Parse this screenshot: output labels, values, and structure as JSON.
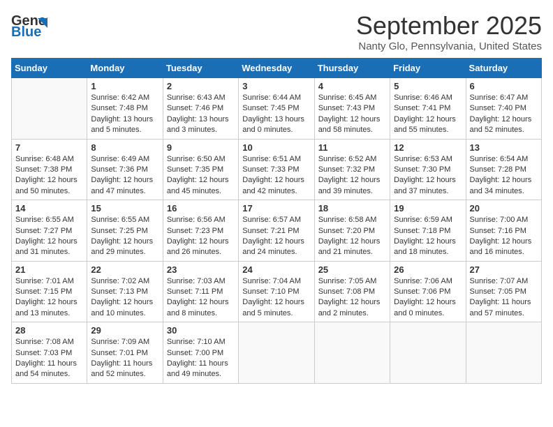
{
  "header": {
    "logo_general": "General",
    "logo_blue": "Blue",
    "month_title": "September 2025",
    "location": "Nanty Glo, Pennsylvania, United States"
  },
  "weekdays": [
    "Sunday",
    "Monday",
    "Tuesday",
    "Wednesday",
    "Thursday",
    "Friday",
    "Saturday"
  ],
  "weeks": [
    [
      {
        "day": "",
        "info": ""
      },
      {
        "day": "1",
        "info": "Sunrise: 6:42 AM\nSunset: 7:48 PM\nDaylight: 13 hours\nand 5 minutes."
      },
      {
        "day": "2",
        "info": "Sunrise: 6:43 AM\nSunset: 7:46 PM\nDaylight: 13 hours\nand 3 minutes."
      },
      {
        "day": "3",
        "info": "Sunrise: 6:44 AM\nSunset: 7:45 PM\nDaylight: 13 hours\nand 0 minutes."
      },
      {
        "day": "4",
        "info": "Sunrise: 6:45 AM\nSunset: 7:43 PM\nDaylight: 12 hours\nand 58 minutes."
      },
      {
        "day": "5",
        "info": "Sunrise: 6:46 AM\nSunset: 7:41 PM\nDaylight: 12 hours\nand 55 minutes."
      },
      {
        "day": "6",
        "info": "Sunrise: 6:47 AM\nSunset: 7:40 PM\nDaylight: 12 hours\nand 52 minutes."
      }
    ],
    [
      {
        "day": "7",
        "info": "Sunrise: 6:48 AM\nSunset: 7:38 PM\nDaylight: 12 hours\nand 50 minutes."
      },
      {
        "day": "8",
        "info": "Sunrise: 6:49 AM\nSunset: 7:36 PM\nDaylight: 12 hours\nand 47 minutes."
      },
      {
        "day": "9",
        "info": "Sunrise: 6:50 AM\nSunset: 7:35 PM\nDaylight: 12 hours\nand 45 minutes."
      },
      {
        "day": "10",
        "info": "Sunrise: 6:51 AM\nSunset: 7:33 PM\nDaylight: 12 hours\nand 42 minutes."
      },
      {
        "day": "11",
        "info": "Sunrise: 6:52 AM\nSunset: 7:32 PM\nDaylight: 12 hours\nand 39 minutes."
      },
      {
        "day": "12",
        "info": "Sunrise: 6:53 AM\nSunset: 7:30 PM\nDaylight: 12 hours\nand 37 minutes."
      },
      {
        "day": "13",
        "info": "Sunrise: 6:54 AM\nSunset: 7:28 PM\nDaylight: 12 hours\nand 34 minutes."
      }
    ],
    [
      {
        "day": "14",
        "info": "Sunrise: 6:55 AM\nSunset: 7:27 PM\nDaylight: 12 hours\nand 31 minutes."
      },
      {
        "day": "15",
        "info": "Sunrise: 6:55 AM\nSunset: 7:25 PM\nDaylight: 12 hours\nand 29 minutes."
      },
      {
        "day": "16",
        "info": "Sunrise: 6:56 AM\nSunset: 7:23 PM\nDaylight: 12 hours\nand 26 minutes."
      },
      {
        "day": "17",
        "info": "Sunrise: 6:57 AM\nSunset: 7:21 PM\nDaylight: 12 hours\nand 24 minutes."
      },
      {
        "day": "18",
        "info": "Sunrise: 6:58 AM\nSunset: 7:20 PM\nDaylight: 12 hours\nand 21 minutes."
      },
      {
        "day": "19",
        "info": "Sunrise: 6:59 AM\nSunset: 7:18 PM\nDaylight: 12 hours\nand 18 minutes."
      },
      {
        "day": "20",
        "info": "Sunrise: 7:00 AM\nSunset: 7:16 PM\nDaylight: 12 hours\nand 16 minutes."
      }
    ],
    [
      {
        "day": "21",
        "info": "Sunrise: 7:01 AM\nSunset: 7:15 PM\nDaylight: 12 hours\nand 13 minutes."
      },
      {
        "day": "22",
        "info": "Sunrise: 7:02 AM\nSunset: 7:13 PM\nDaylight: 12 hours\nand 10 minutes."
      },
      {
        "day": "23",
        "info": "Sunrise: 7:03 AM\nSunset: 7:11 PM\nDaylight: 12 hours\nand 8 minutes."
      },
      {
        "day": "24",
        "info": "Sunrise: 7:04 AM\nSunset: 7:10 PM\nDaylight: 12 hours\nand 5 minutes."
      },
      {
        "day": "25",
        "info": "Sunrise: 7:05 AM\nSunset: 7:08 PM\nDaylight: 12 hours\nand 2 minutes."
      },
      {
        "day": "26",
        "info": "Sunrise: 7:06 AM\nSunset: 7:06 PM\nDaylight: 12 hours\nand 0 minutes."
      },
      {
        "day": "27",
        "info": "Sunrise: 7:07 AM\nSunset: 7:05 PM\nDaylight: 11 hours\nand 57 minutes."
      }
    ],
    [
      {
        "day": "28",
        "info": "Sunrise: 7:08 AM\nSunset: 7:03 PM\nDaylight: 11 hours\nand 54 minutes."
      },
      {
        "day": "29",
        "info": "Sunrise: 7:09 AM\nSunset: 7:01 PM\nDaylight: 11 hours\nand 52 minutes."
      },
      {
        "day": "30",
        "info": "Sunrise: 7:10 AM\nSunset: 7:00 PM\nDaylight: 11 hours\nand 49 minutes."
      },
      {
        "day": "",
        "info": ""
      },
      {
        "day": "",
        "info": ""
      },
      {
        "day": "",
        "info": ""
      },
      {
        "day": "",
        "info": ""
      }
    ]
  ]
}
